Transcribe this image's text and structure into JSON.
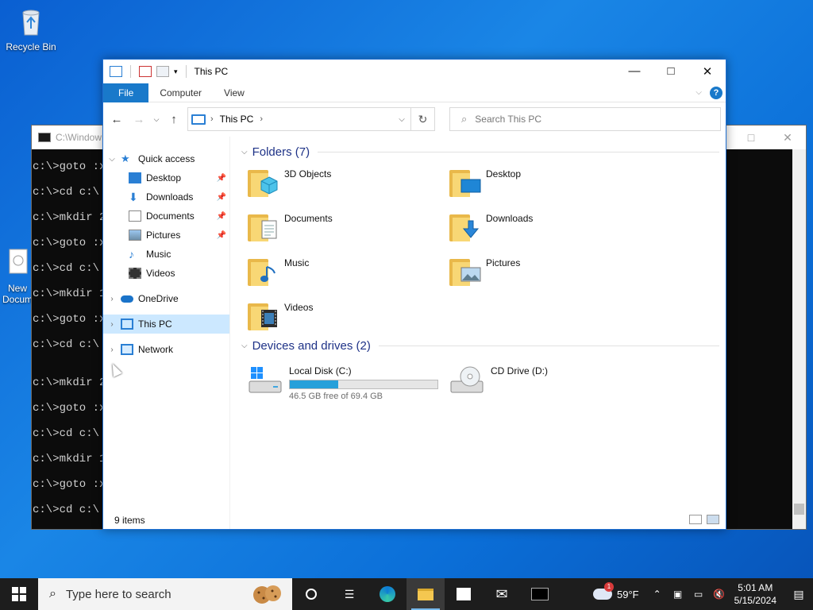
{
  "desktop": {
    "recycle_bin_label": "Recycle Bin",
    "new_doc_label_1": "New",
    "new_doc_label_2": "Docum"
  },
  "console": {
    "title": "C:\\Window",
    "lines": [
      "c:\\>goto :x",
      "c:\\>cd c:\\",
      "c:\\>mkdir 2",
      "c:\\>goto :x",
      "c:\\>cd c:\\",
      "c:\\>mkdir 1",
      "c:\\>goto :x",
      "c:\\>cd c:\\",
      "",
      "c:\\>mkdir 2",
      "c:\\>goto :x",
      "c:\\>cd c:\\",
      "c:\\>mkdir 1",
      "c:\\>goto :x",
      "c:\\>cd c:\\"
    ]
  },
  "explorer": {
    "title": "This PC",
    "ribbon": {
      "file": "File",
      "computer": "Computer",
      "view": "View"
    },
    "address": {
      "crumb": "This PC"
    },
    "search_placeholder": "Search This PC",
    "nav": {
      "quick_access": "Quick access",
      "desktop": "Desktop",
      "downloads": "Downloads",
      "documents": "Documents",
      "pictures": "Pictures",
      "music": "Music",
      "videos": "Videos",
      "onedrive": "OneDrive",
      "this_pc": "This PC",
      "network": "Network"
    },
    "folders_heading": "Folders (7)",
    "folders": [
      "3D Objects",
      "Desktop",
      "Documents",
      "Downloads",
      "Music",
      "Pictures",
      "Videos"
    ],
    "devices_heading": "Devices and drives (2)",
    "drives": [
      {
        "name": "Local Disk (C:)",
        "free_text": "46.5 GB free of 69.4 GB",
        "used_fraction": 0.33
      },
      {
        "name": "CD Drive (D:)"
      }
    ],
    "status": "9 items"
  },
  "taskbar": {
    "search_placeholder": "Type here to search",
    "weather_temp": "59°F",
    "weather_badge": "1",
    "time": "5:01 AM",
    "date": "5/15/2024"
  },
  "colors": {
    "accent": "#1979ca",
    "selection": "#cce8ff",
    "drive_bar": "#26a0da",
    "group_heading": "#1e3287"
  }
}
